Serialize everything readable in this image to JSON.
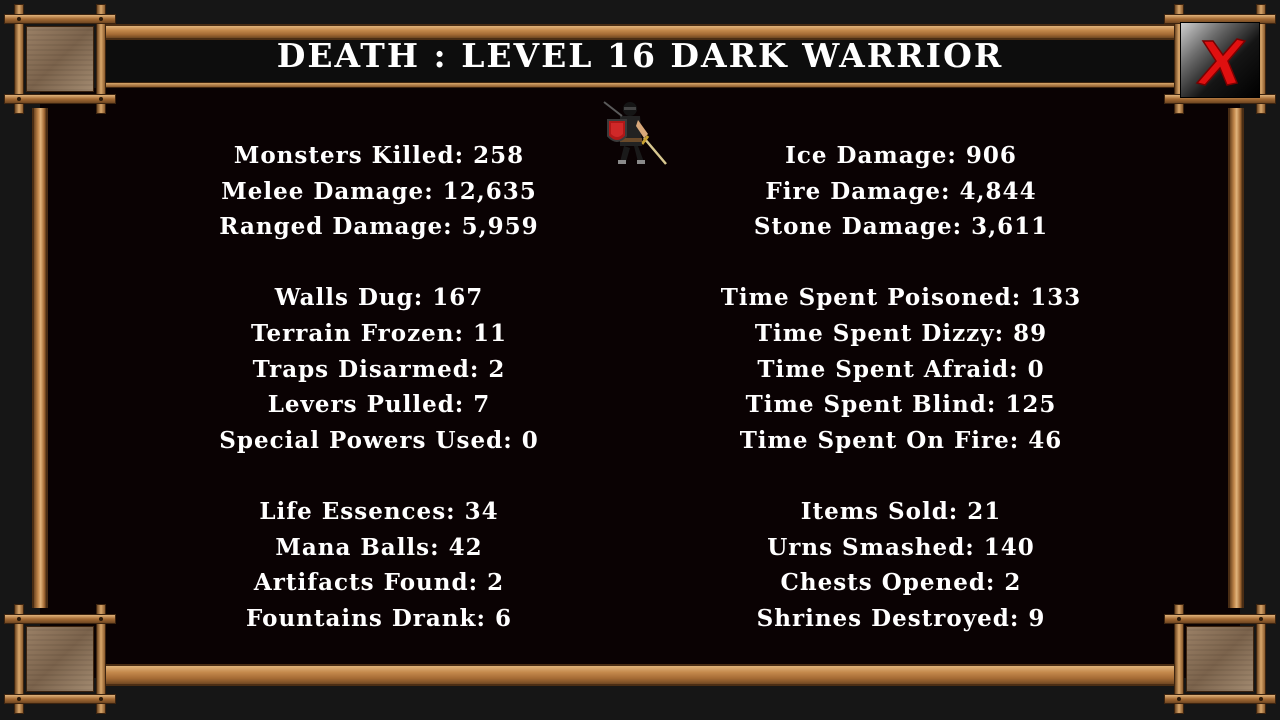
{
  "title": "DEATH : LEVEL 16 DARK WARRIOR",
  "close_icon": "close-x-icon",
  "sprite_icon": "dark-warrior-sprite",
  "colors": {
    "close_x": "#e01010",
    "text": "#ffffff",
    "wood": "#c4894c",
    "background": "#0a0203"
  },
  "left_stats": [
    [
      "Monsters Killed: 258",
      "Melee Damage: 12,635",
      "Ranged Damage: 5,959"
    ],
    [
      "Walls Dug: 167",
      "Terrain Frozen: 11",
      "Traps Disarmed: 2",
      "Levers Pulled: 7",
      "Special Powers Used: 0"
    ],
    [
      "Life Essences: 34",
      "Mana Balls: 42",
      "Artifacts Found: 2",
      "Fountains Drank: 6"
    ]
  ],
  "right_stats": [
    [
      "Ice Damage: 906",
      "Fire Damage: 4,844",
      "Stone Damage: 3,611"
    ],
    [
      "Time Spent Poisoned: 133",
      "Time Spent Dizzy: 89",
      "Time Spent Afraid: 0",
      "Time Spent Blind: 125",
      "Time Spent On Fire: 46"
    ],
    [
      "Items Sold: 21",
      "Urns Smashed: 140",
      "Chests Opened: 2",
      "Shrines Destroyed: 9"
    ]
  ]
}
